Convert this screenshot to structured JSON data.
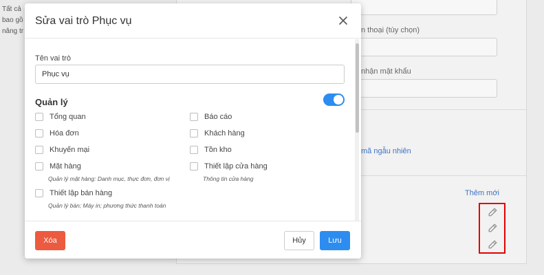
{
  "background": {
    "left_text_lines": [
      "Tất cả",
      "bao gồ",
      "nâng tr"
    ],
    "phone_label": "n thoại (tùy chọn)",
    "confirm_password_label": "nhận mật khẩu",
    "random_code_link": "mã ngẫu nhiên",
    "add_new_link": "Thêm mới"
  },
  "modal": {
    "title": "Sửa vai trò Phục vụ",
    "role_name_label": "Tên vai trò",
    "role_name_value": "Phục vụ",
    "section_title": "Quản lý",
    "section_enabled": true,
    "permissions": {
      "overview": {
        "label": "Tổng quan",
        "checked": false
      },
      "reports": {
        "label": "Báo cáo",
        "checked": false
      },
      "invoices": {
        "label": "Hóa đơn",
        "checked": false
      },
      "customers": {
        "label": "Khách hàng",
        "checked": false
      },
      "promotions": {
        "label": "Khuyến mại",
        "checked": false
      },
      "inventory": {
        "label": "Tồn kho",
        "checked": false
      },
      "products": {
        "label": "Mặt hàng",
        "checked": false,
        "description": "Quản lý mặt hàng: Danh mục, thực đơn, đơn vị"
      },
      "store_settings": {
        "label": "Thiết lập cửa hàng",
        "checked": false,
        "description": "Thông tin cửa hàng"
      },
      "sales_settings": {
        "label": "Thiết lập bán hàng",
        "checked": false,
        "description": "Quản lý bàn; Máy in; phương thức thanh toán"
      }
    },
    "buttons": {
      "delete": "Xóa",
      "cancel": "Hủy",
      "save": "Lưu"
    }
  },
  "colors": {
    "primary": "#2d8cf0",
    "danger": "#ec5a3f",
    "highlight_box": "#e10000"
  }
}
